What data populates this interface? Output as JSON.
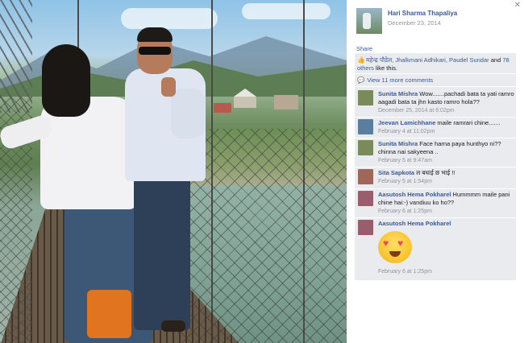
{
  "post": {
    "author": "Hari Sharma Thapaliya",
    "date": "December 23, 2014",
    "share_label": "Share",
    "likes": {
      "names": "महेन्द्र पौडेल, Jhalkmani Adhikari, Paudel Sundar",
      "and_label": "and",
      "others": "78 others",
      "suffix": "like this."
    },
    "view_more": "View 11 more comments",
    "close_glyph": "✕"
  },
  "comments": [
    {
      "name": "Sunita Mishra",
      "text": "Wow.......pachadi bata ta yati ramro aagadi bata ta jhn kasto ramro hola??",
      "time": "December 25, 2014 at 6:02pm",
      "avatar_color": "#7b8a5a"
    },
    {
      "name": "Jeevan Lamichhane",
      "text": "maile ramrari chine.......",
      "time": "February 4 at 11:02pm",
      "avatar_color": "#5a7f9e"
    },
    {
      "name": "Sunita Mishra",
      "text": "Face harna paya hunthyo ni?? chinna nai sakyeena ..",
      "time": "February 5 at 9:47am",
      "avatar_color": "#7b8a5a"
    },
    {
      "name": "Sita Sapkota",
      "text": "ल बधाई छ भाई !!",
      "time": "February 5 at 1:54pm",
      "avatar_color": "#a0665a"
    },
    {
      "name": "Aasutosh Hema Pokharel",
      "text": "Hummmm maile pani chine hai:-) vandiuu ko ho??",
      "time": "February 6 at 1:25pm",
      "avatar_color": "#9a5d6e"
    },
    {
      "name": "Aasutosh Hema Pokharel",
      "text": "",
      "time": "February 6 at 1:25pm",
      "avatar_color": "#9a5d6e",
      "sticker": "heart-eyes-emoji"
    }
  ],
  "colors": {
    "link_blue": "#3b5998",
    "muted_gray": "#90949c",
    "comment_bg": "#e9ebee"
  }
}
